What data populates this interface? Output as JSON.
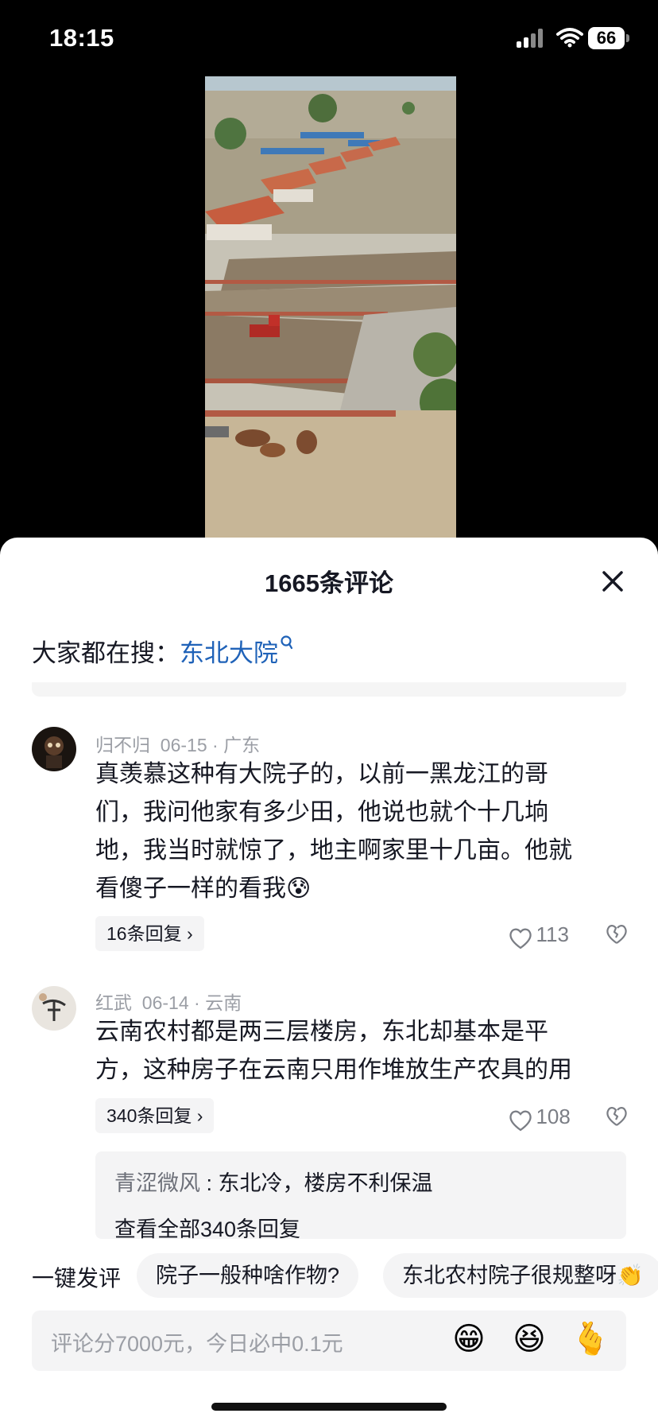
{
  "status": {
    "time": "18:15",
    "battery": "66"
  },
  "header": {
    "title": "1665条评论"
  },
  "hot_search": {
    "label": "大家都在搜：",
    "keyword": "东北大院"
  },
  "comments": [
    {
      "user": "归不归",
      "date": "06-15",
      "location": "广东",
      "text_lines": [
        "真羡慕这种有大院子的，以前一黑龙江的哥",
        "们，我问他家有多少田，他说也就个十几垧",
        "地，我当时就惊了，地主啊家里十几亩。他就",
        "看傻子一样的看我😰"
      ],
      "replies_label": "16条回复",
      "likes": "113"
    },
    {
      "user": "红武",
      "date": "06-14",
      "location": "云南",
      "text_lines": [
        "云南农村都是两三层楼房，东北却基本是平",
        "方，这种房子在云南只用作堆放生产农具的用"
      ],
      "replies_label": "340条回复",
      "likes": "108",
      "sub_reply": {
        "user": "青涩微风",
        "text": "东北冷，楼房不利保温"
      },
      "view_all": "查看全部340条回复"
    }
  ],
  "quick": {
    "label": "一键发评",
    "chips": [
      "院子一般种啥作物?",
      "东北农村院子很规整呀👏"
    ]
  },
  "input": {
    "placeholder": "评论分7000元，今日必中0.1元"
  },
  "emojis": [
    "😁",
    "😆",
    "🫰"
  ],
  "colors": {
    "accent_link": "#1f62b8",
    "sheet_bg": "#ffffff",
    "chip_bg": "#f4f4f5"
  }
}
